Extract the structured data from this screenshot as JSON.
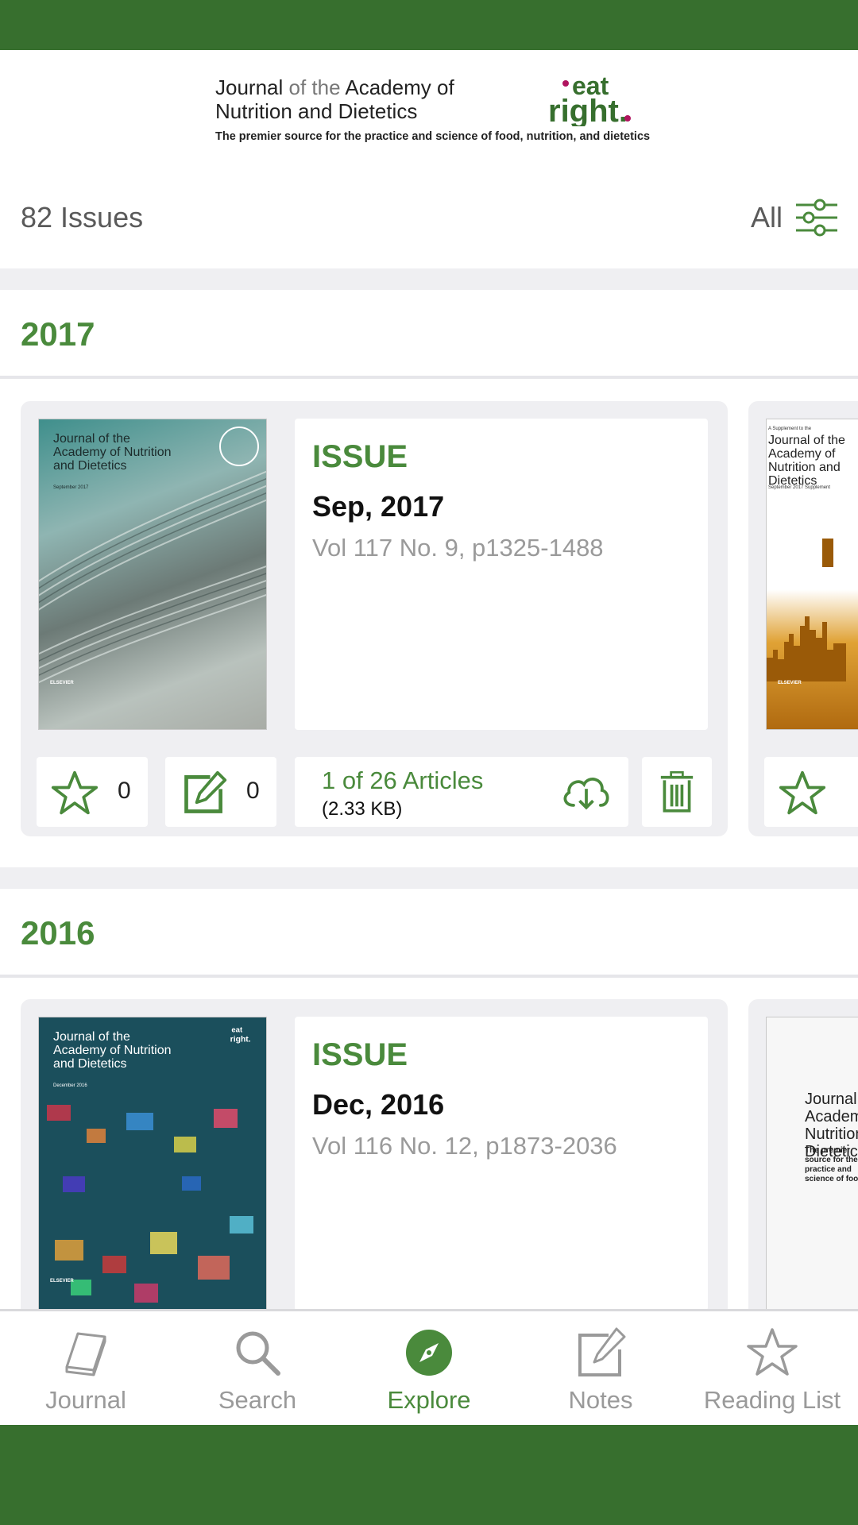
{
  "header": {
    "title_line1_part1": "Journal",
    "title_line1_part2": "of the",
    "title_line1_part3": "Academy of",
    "title_line2": "Nutrition and Dietetics",
    "tagline": "The premier source for the practice and science of food, nutrition, and dietetics",
    "logo_top": "eat",
    "logo_bottom": "right."
  },
  "summary": {
    "issue_count": "82 Issues",
    "filter_label": "All"
  },
  "sections": [
    {
      "year": "2017",
      "issue": {
        "type": "ISSUE",
        "date": "Sep, 2017",
        "volume": "Vol 117 No. 9, p1325-1488",
        "favorites": "0",
        "notes": "0",
        "articles": "1 of 26 Articles",
        "size": "(2.33 KB)",
        "cover_title": "Journal of the Academy of Nutrition and Dietetics",
        "cover_date": "September 2017",
        "publisher": "ELSEVIER"
      },
      "next_cover": {
        "supplement": "A Supplement to the",
        "title": "Journal of the Academy of Nutrition and Dietetics",
        "date": "September 2017 Supplement",
        "publisher": "ELSEVIER"
      }
    },
    {
      "year": "2016",
      "issue": {
        "type": "ISSUE",
        "date": "Dec, 2016",
        "volume": "Vol 116 No. 12, p1873-2036",
        "cover_title": "Journal of the Academy of Nutrition and Dietetics",
        "cover_date": "December 2016",
        "publisher": "ELSEVIER"
      },
      "next_cover": {
        "title": "Journal of the Academy of Nutrition and Dietetics",
        "tagline": "The premier source for the practice and science of food"
      }
    }
  ],
  "nav": [
    {
      "label": "Journal",
      "icon": "journal-icon",
      "active": false
    },
    {
      "label": "Search",
      "icon": "search-icon",
      "active": false
    },
    {
      "label": "Explore",
      "icon": "compass-icon",
      "active": true
    },
    {
      "label": "Notes",
      "icon": "notes-icon",
      "active": false
    },
    {
      "label": "Reading List",
      "icon": "star-icon",
      "active": false
    }
  ],
  "colors": {
    "brand_green": "#376f2e",
    "accent_green": "#4a8a3c",
    "logo_magenta": "#b0145f"
  }
}
